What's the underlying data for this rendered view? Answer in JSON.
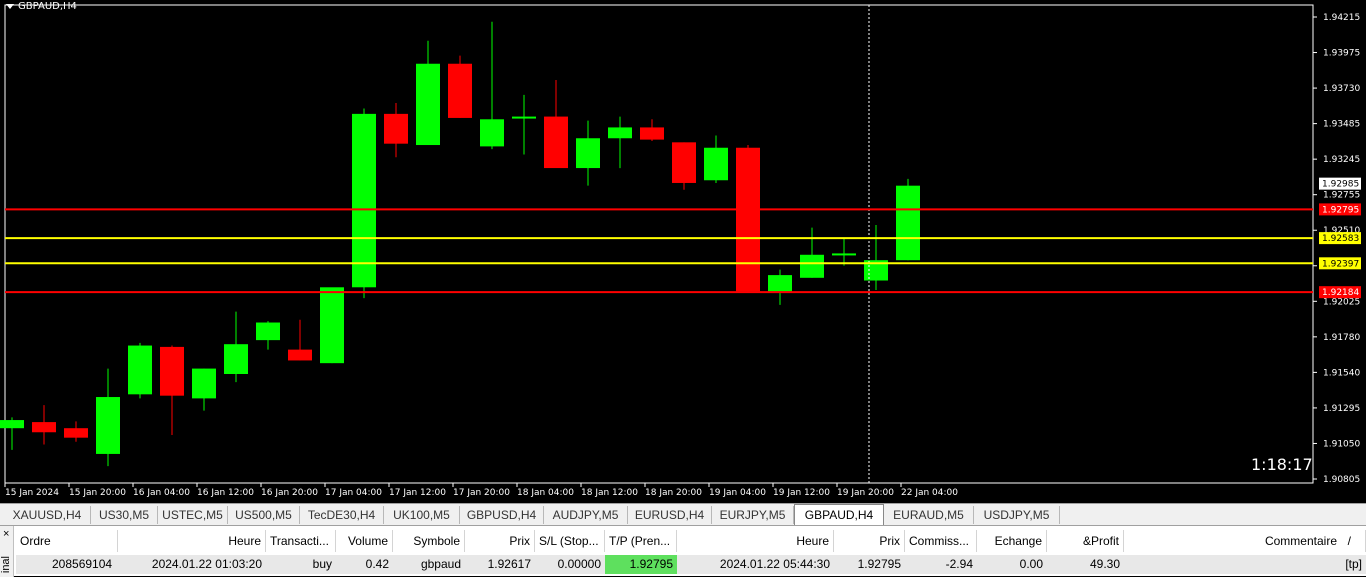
{
  "chart": {
    "symbol_label": "GBPAUD,H4",
    "countdown": "1:18:17",
    "price_ticks": [
      "1.94215",
      "1.93975",
      "1.93730",
      "1.93485",
      "1.93245",
      "1.92755",
      "1.92510",
      "1.92270",
      "1.92025",
      "1.91780",
      "1.91540",
      "1.91295",
      "1.91050",
      "1.90805"
    ],
    "time_ticks": [
      "15 Jan 2024",
      "15 Jan 20:00",
      "16 Jan 04:00",
      "16 Jan 12:00",
      "16 Jan 20:00",
      "17 Jan 04:00",
      "17 Jan 12:00",
      "17 Jan 20:00",
      "18 Jan 04:00",
      "18 Jan 12:00",
      "18 Jan 20:00",
      "19 Jan 04:00",
      "19 Jan 12:00",
      "19 Jan 20:00",
      "22 Jan 04:00"
    ],
    "current_price_label": "1.92985",
    "levels": [
      {
        "label": "1.92795",
        "color": "#ff0000",
        "text_color": "#ffffff",
        "price": 1.92795
      },
      {
        "label": "1.92583",
        "color": "#ffff00",
        "text_color": "#000000",
        "price": 1.92583
      },
      {
        "label": "1.92397",
        "color": "#ffff00",
        "text_color": "#000000",
        "price": 1.92397
      },
      {
        "label": "1.92184",
        "color": "#ff0000",
        "text_color": "#ffffff",
        "price": 1.92184
      }
    ],
    "bull_color": "#00ff00",
    "bear_color": "#ff0000",
    "price_min": 1.90805,
    "price_max": 1.94215,
    "candles": [
      {
        "o": 1.9118,
        "h": 1.9126,
        "l": 1.9102,
        "c": 1.9124
      },
      {
        "o": 1.91225,
        "h": 1.9135,
        "l": 1.9106,
        "c": 1.9115
      },
      {
        "o": 1.9118,
        "h": 1.9123,
        "l": 1.9108,
        "c": 1.9111
      },
      {
        "o": 1.9099,
        "h": 1.9162,
        "l": 1.909,
        "c": 1.9141
      },
      {
        "o": 1.9143,
        "h": 1.9181,
        "l": 1.914,
        "c": 1.9179
      },
      {
        "o": 1.9178,
        "h": 1.9179,
        "l": 1.9113,
        "c": 1.9142
      },
      {
        "o": 1.914,
        "h": 1.9162,
        "l": 1.9131,
        "c": 1.9162
      },
      {
        "o": 1.9158,
        "h": 1.9204,
        "l": 1.9152,
        "c": 1.918
      },
      {
        "o": 1.9183,
        "h": 1.9197,
        "l": 1.9176,
        "c": 1.9196
      },
      {
        "o": 1.9176,
        "h": 1.9198,
        "l": 1.9168,
        "c": 1.9168
      },
      {
        "o": 1.9166,
        "h": 1.9219,
        "l": 1.9166,
        "c": 1.9222
      },
      {
        "o": 1.9222,
        "h": 1.9354,
        "l": 1.9214,
        "c": 1.935
      },
      {
        "o": 1.935,
        "h": 1.9358,
        "l": 1.9318,
        "c": 1.9328
      },
      {
        "o": 1.9327,
        "h": 1.9404,
        "l": 1.9327,
        "c": 1.9387
      },
      {
        "o": 1.9387,
        "h": 1.9393,
        "l": 1.9347,
        "c": 1.9347
      },
      {
        "o": 1.9326,
        "h": 1.9418,
        "l": 1.9324,
        "c": 1.9346
      },
      {
        "o": 1.9347,
        "h": 1.9364,
        "l": 1.932,
        "c": 1.9348
      },
      {
        "o": 1.9348,
        "h": 1.9375,
        "l": 1.9313,
        "c": 1.931
      },
      {
        "o": 1.931,
        "h": 1.9345,
        "l": 1.9297,
        "c": 1.9332
      },
      {
        "o": 1.9332,
        "h": 1.9348,
        "l": 1.931,
        "c": 1.934
      },
      {
        "o": 1.934,
        "h": 1.9346,
        "l": 1.933,
        "c": 1.9331
      },
      {
        "o": 1.9329,
        "h": 1.9329,
        "l": 1.9294,
        "c": 1.9299
      },
      {
        "o": 1.9301,
        "h": 1.9334,
        "l": 1.9299,
        "c": 1.9325
      },
      {
        "o": 1.9325,
        "h": 1.9327,
        "l": 1.9219,
        "c": 1.9219
      },
      {
        "o": 1.9219,
        "h": 1.9235,
        "l": 1.9209,
        "c": 1.9231
      },
      {
        "o": 1.9229,
        "h": 1.9266,
        "l": 1.9229,
        "c": 1.9246
      },
      {
        "o": 1.9246,
        "h": 1.9258,
        "l": 1.9238,
        "c": 1.9247
      },
      {
        "o": 1.9227,
        "h": 1.9268,
        "l": 1.922,
        "c": 1.9242
      },
      {
        "o": 1.9242,
        "h": 1.9302,
        "l": 1.9242,
        "c": 1.9297
      }
    ]
  },
  "tabs": [
    {
      "label": "XAUUSD,H4",
      "active": false
    },
    {
      "label": "US30,M5",
      "active": false
    },
    {
      "label": "USTEC,M5",
      "active": false
    },
    {
      "label": "US500,M5",
      "active": false
    },
    {
      "label": "TecDE30,H4",
      "active": false
    },
    {
      "label": "UK100,M5",
      "active": false
    },
    {
      "label": "GBPUSD,H4",
      "active": false
    },
    {
      "label": "AUDJPY,M5",
      "active": false
    },
    {
      "label": "EURUSD,H4",
      "active": false
    },
    {
      "label": "EURJPY,M5",
      "active": false
    },
    {
      "label": "GBPAUD,H4",
      "active": true
    },
    {
      "label": "EURAUD,M5",
      "active": false
    },
    {
      "label": "USDJPY,M5",
      "active": false
    }
  ],
  "terminal": {
    "close_label": "×",
    "side_label": "inal",
    "columns": [
      "Ordre",
      "Heure",
      "Transacti...",
      "Volume",
      "Symbole",
      "Prix",
      "S/L (Stop...",
      "T/P (Pren...",
      "Heure",
      "Prix",
      "Commiss...",
      "Echange",
      "&Profit",
      "Commentaire"
    ],
    "sort_marker": "/",
    "row": [
      "208569104",
      "2024.01.22 01:03:20",
      "buy",
      "0.42",
      "gbpaud",
      "1.92617",
      "0.00000",
      "1.92795",
      "2024.01.22 05:44:30",
      "1.92795",
      "-2.94",
      "0.00",
      "49.30",
      "[tp]"
    ]
  }
}
